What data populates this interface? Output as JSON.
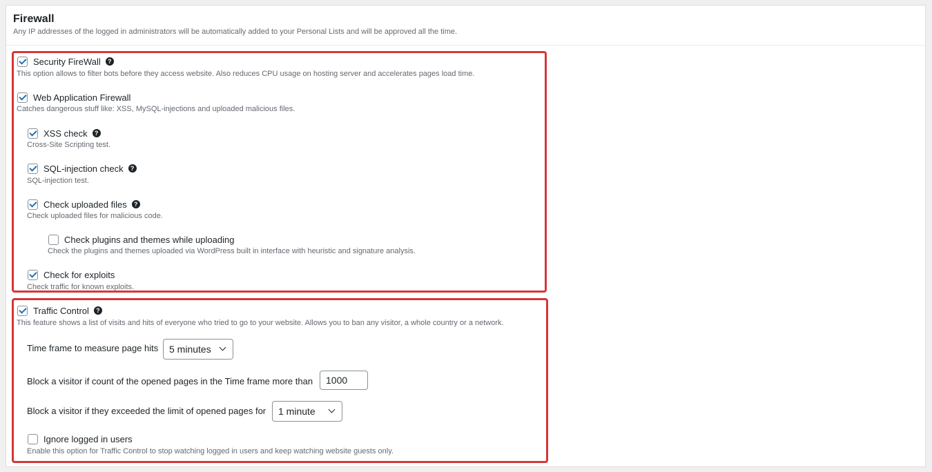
{
  "panel": {
    "title": "Firewall",
    "subtitle": "Any IP addresses of the logged in administrators will be automatically added to your Personal Lists and will be approved all the time."
  },
  "firewall_options": [
    {
      "label": "Security FireWall",
      "desc": "This option allows to filter bots before they access website. Also reduces CPU usage on hosting server and accelerates pages load time.",
      "checked": true,
      "help": true
    },
    {
      "label": "Web Application Firewall",
      "desc": "Catches dangerous stuff like: XSS, MySQL-injections and uploaded malicious files.",
      "checked": true,
      "help": false
    },
    {
      "label": "XSS check",
      "desc": "Cross-Site Scripting test.",
      "checked": true,
      "help": true
    },
    {
      "label": "SQL-injection check",
      "desc": "SQL-injection test.",
      "checked": true,
      "help": true
    },
    {
      "label": "Check uploaded files",
      "desc": "Check uploaded files for malicious code.",
      "checked": true,
      "help": true
    },
    {
      "label": "Check plugins and themes while uploading",
      "desc": "Check the plugins and themes uploaded via WordPress built in interface with heuristic and signature analysis.",
      "checked": false,
      "help": false
    },
    {
      "label": "Check for exploits",
      "desc": "Check traffic for known exploits.",
      "checked": true,
      "help": false
    }
  ],
  "traffic_control": {
    "label": "Traffic Control",
    "desc": "This feature shows a list of visits and hits of everyone who tried to go to your website. Allows you to ban any visitor, a whole country or a network.",
    "checked": true,
    "time_frame_label": "Time frame to measure page hits",
    "time_frame_value": "5 minutes",
    "block_count_label": "Block a visitor if count of the opened pages in the Time frame more than",
    "block_count_value": "1000",
    "block_period_label": "Block a visitor if they exceeded the limit of opened pages for",
    "block_period_value": "1 minute",
    "ignore_label": "Ignore logged in users",
    "ignore_desc": "Enable this option for Traffic Control to stop watching logged in users and keep watching website guests only.",
    "ignore_checked": false
  },
  "icons": {
    "help": "question-circle-icon",
    "check": "checkmark-icon",
    "dropdown": "chevron-down-icon"
  },
  "colors": {
    "highlight": "#d63638",
    "checkbox": "#2271b1"
  }
}
